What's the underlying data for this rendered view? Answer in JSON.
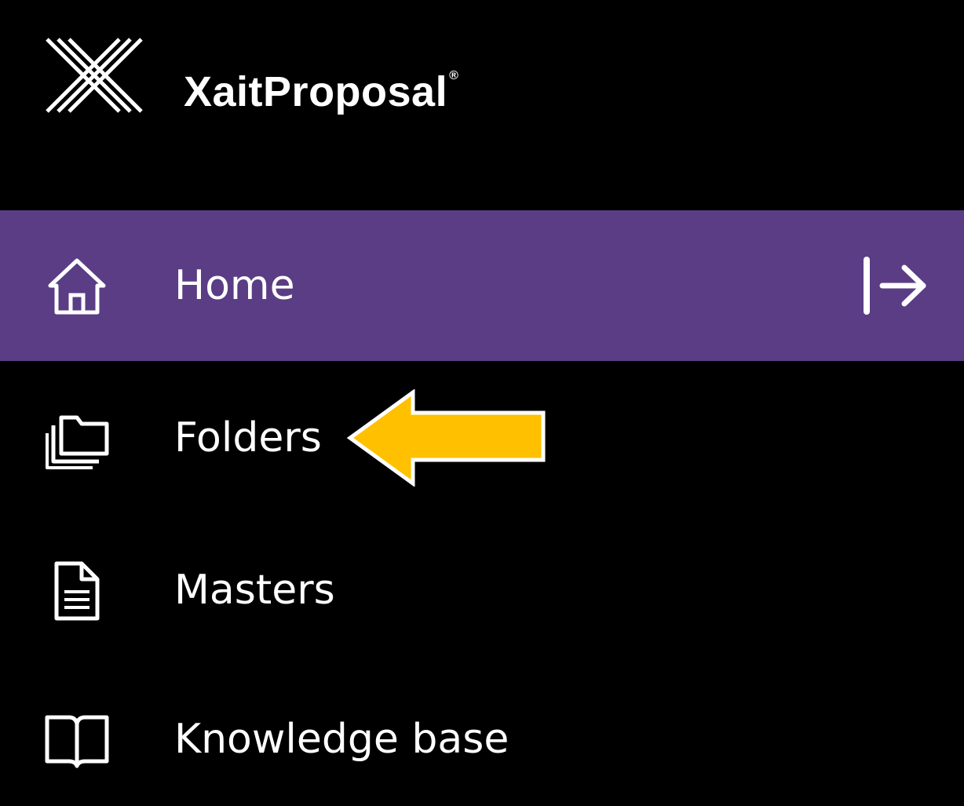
{
  "app": {
    "brand_name": "XaitProposal",
    "brand_reg": "®"
  },
  "colors": {
    "background": "#000000",
    "active_item": "#5a3d85",
    "text": "#ffffff",
    "annotation_arrow": "#ffc000"
  },
  "nav": {
    "items": [
      {
        "label": "Home",
        "icon": "home-icon",
        "active": true
      },
      {
        "label": "Folders",
        "icon": "folders-icon",
        "active": false
      },
      {
        "label": "Masters",
        "icon": "document-icon",
        "active": false
      },
      {
        "label": "Knowledge base",
        "icon": "book-icon",
        "active": false
      }
    ],
    "collapse_icon": "collapse-arrow-icon"
  },
  "annotation": {
    "icon": "pointer-arrow-icon",
    "target": "Folders"
  }
}
